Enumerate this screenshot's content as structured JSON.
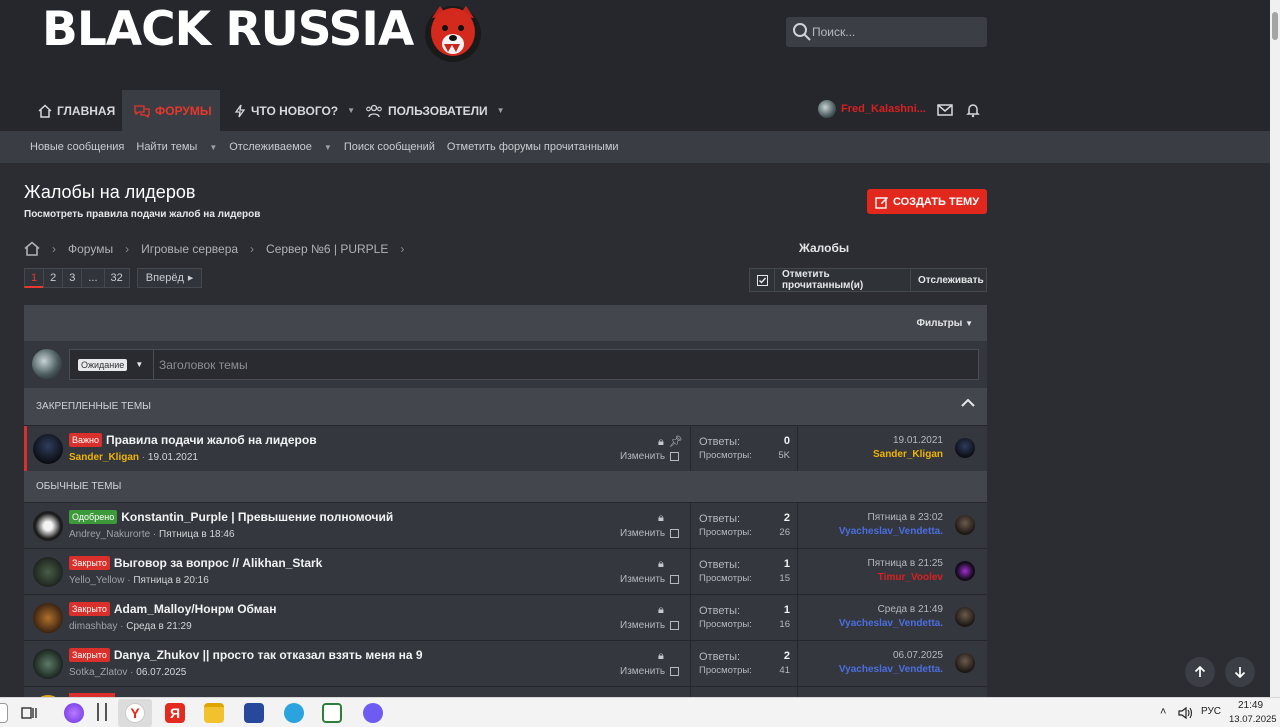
{
  "header": {
    "logo_text": "BLACK RUSSIA",
    "search_placeholder": "Поиск...",
    "nav": [
      {
        "label": "ГЛАВНАЯ"
      },
      {
        "label": "ФОРУМЫ",
        "active": true
      },
      {
        "label": "ЧТО НОВОГО?"
      },
      {
        "label": "ПОЛЬЗОВАТЕЛИ"
      }
    ],
    "username": "Fred_Kalashni..."
  },
  "subnav": [
    "Новые сообщения",
    "Найти темы",
    "Отслеживаемое",
    "Поиск сообщений",
    "Отметить форумы прочитанными"
  ],
  "page": {
    "title": "Жалобы на лидеров",
    "description": "Посмотреть правила подачи жалоб на лидеров",
    "create_button": "СОЗДАТЬ ТЕМУ"
  },
  "breadcrumbs": [
    "Форумы",
    "Игровые сервера",
    "Сервер №6 | PURPLE",
    "Жалобы"
  ],
  "pagination": {
    "pages": [
      "1",
      "2",
      "3",
      "...",
      "32"
    ],
    "next": "Вперёд"
  },
  "toolbar": {
    "mark_read": "Отметить прочитанным(и)",
    "watch": "Отслеживать",
    "filters": "Фильтры"
  },
  "new_thread": {
    "prefix": "Ожидание",
    "title_placeholder": "Заголовок темы"
  },
  "sections": {
    "sticky": "Закрепленные темы",
    "normal": "Обычные темы"
  },
  "labels": {
    "replies": "Ответы:",
    "views": "Просмотры:",
    "edit": "Изменить"
  },
  "colors": {
    "accent": "#e2281d",
    "approved": "#3d9a3a",
    "closed": "#d9302b",
    "user_gold": "#f0b400",
    "user_blue": "#4a6ee0",
    "user_red": "#d82020"
  },
  "sticky_threads": [
    {
      "prefix": "Важно",
      "title": "Правила подачи жалоб на лидеров",
      "author": "Sander_Kligan",
      "date": "19.01.2021",
      "replies": "0",
      "views": "5K",
      "last_date": "19.01.2021",
      "last_user": "Sander_Kligan"
    }
  ],
  "threads": [
    {
      "prefix": "Одобрено",
      "title": "Konstantin_Purple | Превышение полномочий",
      "author": "Andrey_Nakurorte",
      "date": "Пятница в 18:46",
      "replies": "2",
      "views": "26",
      "last_date": "Пятница в 23:02",
      "last_user": "Vyacheslav_Vendetta."
    },
    {
      "prefix": "Закрыто",
      "title": "Выговор за вопрос // Alikhan_Stark",
      "author": "Yello_Yellow",
      "date": "Пятница в 20:16",
      "replies": "1",
      "views": "15",
      "last_date": "Пятница в 21:25",
      "last_user": "Timur_Voolev"
    },
    {
      "prefix": "Закрыто",
      "title": "Adam_Malloy/Нонрм Обман",
      "author": "dimashbay",
      "date": "Среда в 21:29",
      "replies": "1",
      "views": "16",
      "last_date": "Среда в 21:49",
      "last_user": "Vyacheslav_Vendetta."
    },
    {
      "prefix": "Закрыто",
      "title": "Danya_Zhukov || просто так отказал взять меня на 9",
      "author": "Sotka_Zlatov",
      "date": "06.07.2025",
      "replies": "2",
      "views": "41",
      "last_date": "06.07.2025",
      "last_user": "Vyacheslav_Vendetta."
    }
  ],
  "taskbar": {
    "lang": "РУС",
    "time": "21:49",
    "date": "13.07.2025"
  }
}
